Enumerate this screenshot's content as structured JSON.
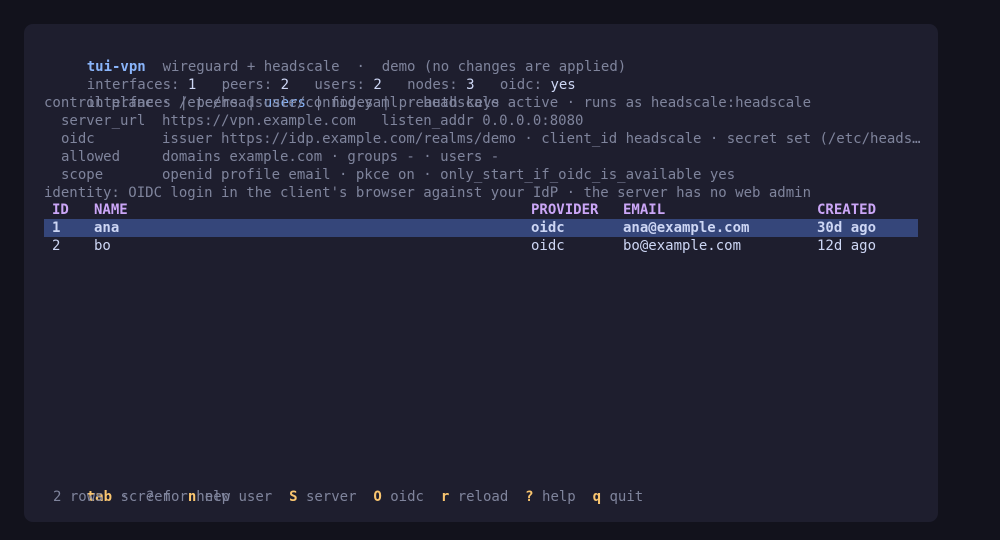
{
  "header": {
    "app_name": "tui-vpn",
    "subtitle": "wireguard + headscale  ·  demo (no changes are applied)"
  },
  "stats": [
    {
      "label": "interfaces:",
      "value": "1"
    },
    {
      "label": "peers:",
      "value": "2"
    },
    {
      "label": "users:",
      "value": "2"
    },
    {
      "label": "nodes:",
      "value": "3"
    },
    {
      "label": "oidc:",
      "value": "yes"
    }
  ],
  "tabs": [
    {
      "label": "interfaces",
      "active": false
    },
    {
      "label": "peers",
      "active": false
    },
    {
      "label": "users",
      "active": true
    },
    {
      "label": "nodes",
      "active": false
    },
    {
      "label": "preauth keys",
      "active": false
    }
  ],
  "tab_separator": " | ",
  "control_plane": "control plane · /etc/headscale/config.yaml · headscale active · runs as headscale:headscale",
  "config": [
    {
      "key": "server_url",
      "value": "https://vpn.example.com   listen_addr 0.0.0.0:8080"
    },
    {
      "key": "oidc",
      "value": "issuer https://idp.example.com/realms/demo · client_id headscale · secret set (/etc/heads…"
    },
    {
      "key": "allowed",
      "value": "domains example.com · groups - · users -"
    },
    {
      "key": "scope",
      "value": "openid profile email · pkce on · only_start_if_oidc_is_available yes"
    }
  ],
  "identity": "identity: OIDC login in the client's browser against your IdP · the server has no web admin",
  "table": {
    "headers": [
      "ID",
      "NAME",
      "PROVIDER",
      "EMAIL",
      "CREATED"
    ],
    "rows": [
      [
        "1",
        "ana",
        "oidc",
        "ana@example.com",
        "30d ago"
      ],
      [
        "2",
        "bo",
        "oidc",
        "bo@example.com",
        "12d ago"
      ]
    ],
    "selected_row": 0
  },
  "keybinds": [
    {
      "key": "tab",
      "desc": "screen"
    },
    {
      "key": "n",
      "desc": "new user"
    },
    {
      "key": "S",
      "desc": "server"
    },
    {
      "key": "O",
      "desc": "oidc"
    },
    {
      "key": "r",
      "desc": "reload"
    },
    {
      "key": "?",
      "desc": "help"
    },
    {
      "key": "q",
      "desc": "quit"
    }
  ],
  "status": "2 rows  ·  ? for help",
  "colors": {
    "background": "#1e1e2e",
    "accent": "#89b4fa",
    "header": "#cba6f7",
    "key": "#f9c56f",
    "selection": "#35467a"
  }
}
